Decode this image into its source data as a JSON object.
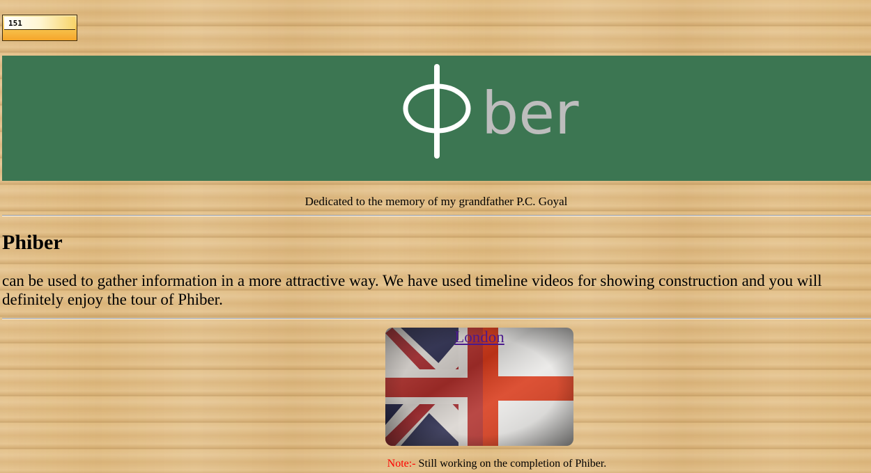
{
  "counter": {
    "value": "151"
  },
  "banner": {
    "logo_glyph": "ɸ",
    "logo_text": "ber",
    "background_color": "#3c7652",
    "glyph_color": "#ffffff",
    "text_color": "#bdbdbd"
  },
  "dedication": "Dedicated to the memory of my grandfather P.C. Goyal",
  "main": {
    "heading": "Phiber",
    "intro": "can be used to gather information in a more attractive way. We have used timeline videos for showing construction and you will definitely enjoy the tour of Phiber."
  },
  "city_card": {
    "link_label": "London",
    "image_icon": "union-jack-st-george-flag"
  },
  "note": {
    "label": "Note:-",
    "text": "Still working on the completion of Phiber.",
    "label_color": "#ff0000"
  }
}
